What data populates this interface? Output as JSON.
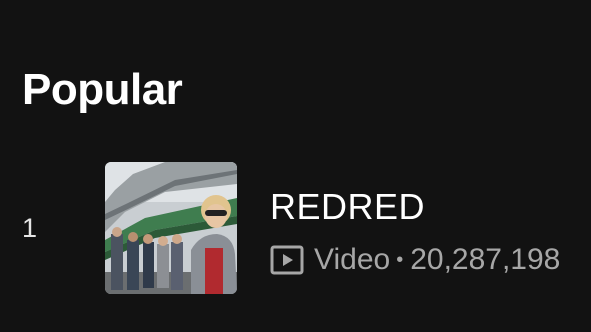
{
  "section": {
    "title": "Popular"
  },
  "tracks": [
    {
      "index": "1",
      "title": "REDRED",
      "type_icon": "video-play-icon",
      "type_label": "Video",
      "separator": "•",
      "plays": "20,287,198"
    }
  ],
  "colors": {
    "background": "#121212",
    "primary_text": "#ffffff",
    "secondary_text": "#a7a7a7"
  }
}
